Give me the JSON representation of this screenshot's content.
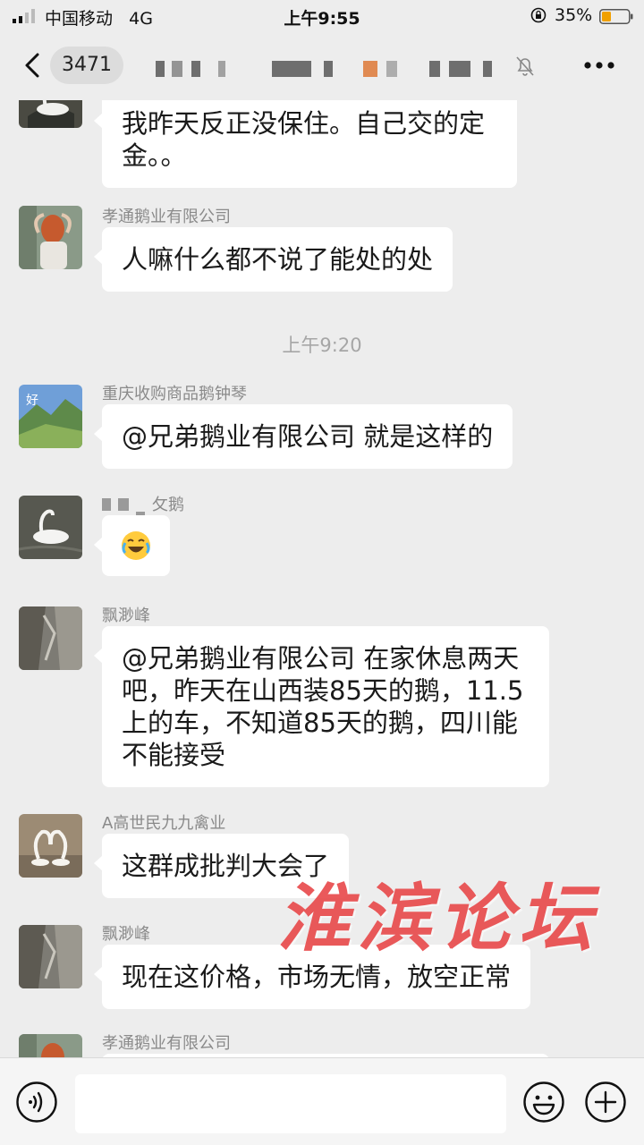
{
  "status_bar": {
    "carrier": "中国移动",
    "network": "4G",
    "time": "上午9:55",
    "battery": "35%",
    "battery_level": 0.35
  },
  "nav": {
    "unread_count": "3471",
    "back_icon": "chevron-left-icon",
    "mute_icon": "bell-muted-icon",
    "more_icon": "more-dots-icon"
  },
  "messages": [
    {
      "sender": "",
      "text": "我昨天反正没保住。自己交的定金。。",
      "avatar": "swan"
    },
    {
      "sender": "孝通鹅业有限公司",
      "text": "人嘛什么都不说了能处的处",
      "avatar": "woman"
    },
    {
      "timestamp": "上午9:20"
    },
    {
      "sender": "重庆收购商品鹅钟琴",
      "text": "@兄弟鹅业有限公司 就是这样的",
      "avatar": "landscape"
    },
    {
      "sender": "攵鹅",
      "text": "",
      "emoji": "laugh-cry-emoji",
      "avatar": "swan"
    },
    {
      "sender": "飘渺峰",
      "text": "@兄弟鹅业有限公司 在家休息两天吧，昨天在山西装85天的鹅，11.5上的车，不知道85天的鹅，四川能不能接受",
      "avatar": "rocks"
    },
    {
      "sender": "A高世民九九禽业",
      "text": "这群成批判大会了",
      "avatar": "swans-heart"
    },
    {
      "sender": "飘渺峰",
      "text": "现在这价格，市场无情，放空正常",
      "avatar": "rocks"
    },
    {
      "sender": "孝通鹅业有限公司",
      "text": "",
      "avatar": "woman"
    }
  ],
  "watermark": "淮滨论坛",
  "input_bar": {
    "voice_icon": "voice-icon",
    "emoji_icon": "emoji-icon",
    "plus_icon": "plus-icon"
  },
  "colors": {
    "background": "#ededed",
    "bubble": "#ffffff",
    "watermark": "#e8484a"
  }
}
